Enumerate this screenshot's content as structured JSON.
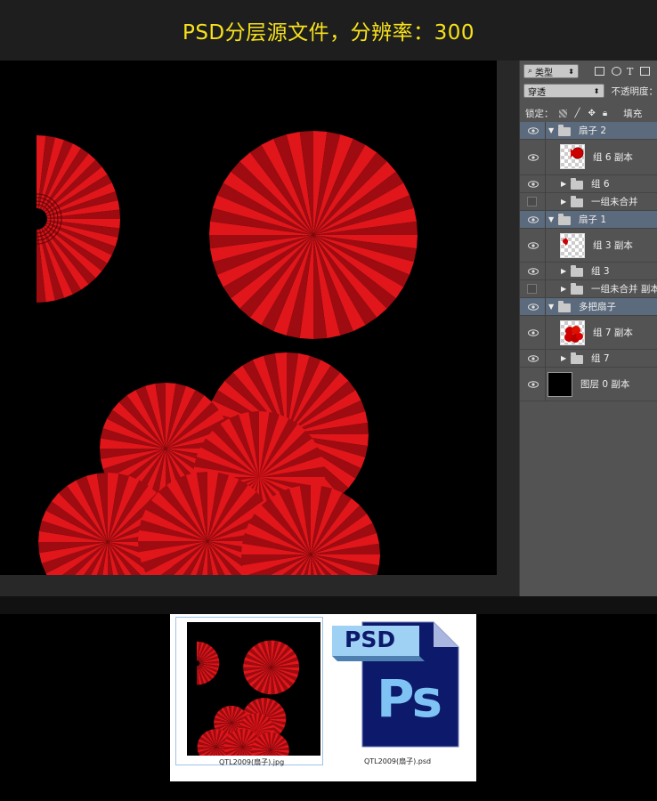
{
  "banner": {
    "title": "PSD分层源文件，分辨率：300"
  },
  "panel": {
    "filter_label": "类型",
    "blend_mode": "穿透",
    "opacity_label": "不透明度：",
    "lock_label": "锁定：",
    "fill_label": "填充"
  },
  "layers": [
    {
      "name": "扇子 2",
      "kind": "group",
      "visible": true,
      "expanded": true
    },
    {
      "name": "组 6 副本",
      "kind": "layer",
      "visible": true
    },
    {
      "name": "组 6",
      "kind": "folder",
      "visible": true
    },
    {
      "name": "一组未合并",
      "kind": "folder",
      "visible": false
    },
    {
      "name": "扇子 1",
      "kind": "group",
      "visible": true,
      "expanded": true
    },
    {
      "name": "组 3 副本",
      "kind": "layer",
      "visible": true
    },
    {
      "name": "组 3",
      "kind": "folder",
      "visible": true
    },
    {
      "name": "一组未合并 副本",
      "kind": "folder",
      "visible": false
    },
    {
      "name": "多把扇子",
      "kind": "group",
      "visible": true,
      "expanded": true
    },
    {
      "name": "组 7 副本",
      "kind": "layer",
      "visible": true
    },
    {
      "name": "组 7",
      "kind": "folder",
      "visible": true
    },
    {
      "name": "图层 0 副本",
      "kind": "layer",
      "visible": true
    }
  ],
  "files": [
    {
      "name": "QTL2009(扇子).jpg",
      "type": "jpg"
    },
    {
      "name": "QTL2009(扇子).psd",
      "type": "psd",
      "badge": "PSD",
      "logo": "Ps"
    }
  ],
  "colors": {
    "banner_text": "#f7e21b",
    "fan_red": "#e0161b",
    "fan_dark": "#9e0b10",
    "psd_navy": "#0d1a6b",
    "psd_blue": "#7fc3f5"
  }
}
